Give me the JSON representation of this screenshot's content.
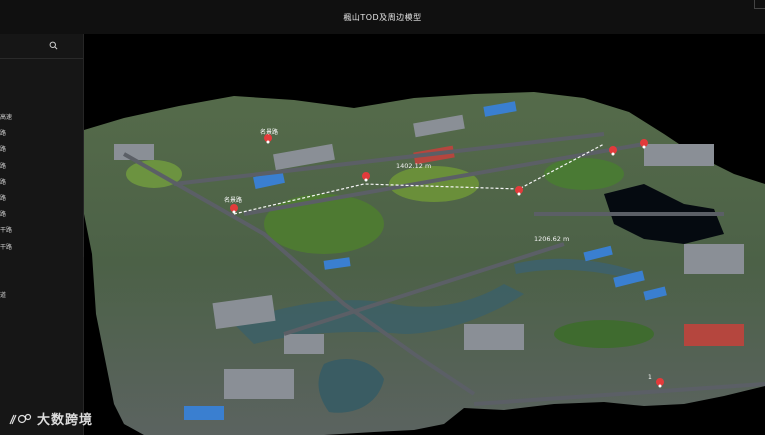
{
  "window": {
    "title": "楓山TOD及周边模型"
  },
  "sidebar": {
    "search_icon": "search-icon",
    "items": [
      {
        "label": "高速"
      },
      {
        "label": "路"
      },
      {
        "label": "路"
      },
      {
        "label": "路"
      },
      {
        "label": "路"
      },
      {
        "label": "路"
      },
      {
        "label": "路"
      },
      {
        "label": "干路"
      },
      {
        "label": "干路"
      },
      {
        "label": ""
      },
      {
        "label": ""
      },
      {
        "label": "道"
      }
    ],
    "collapse_icon": "chevron-left-icon"
  },
  "map": {
    "measurements": [
      "1402.12 m",
      "1206.62 m"
    ],
    "marker_icon": "map-pin-icon",
    "marker_labels": [
      "名景路",
      "名景路",
      "1"
    ]
  },
  "watermark": {
    "text": "大数跨境"
  },
  "colors": {
    "marker": "#e23b3b",
    "titlebar": "#101010",
    "sidebar": "#161616",
    "road": "#5b5f66"
  }
}
